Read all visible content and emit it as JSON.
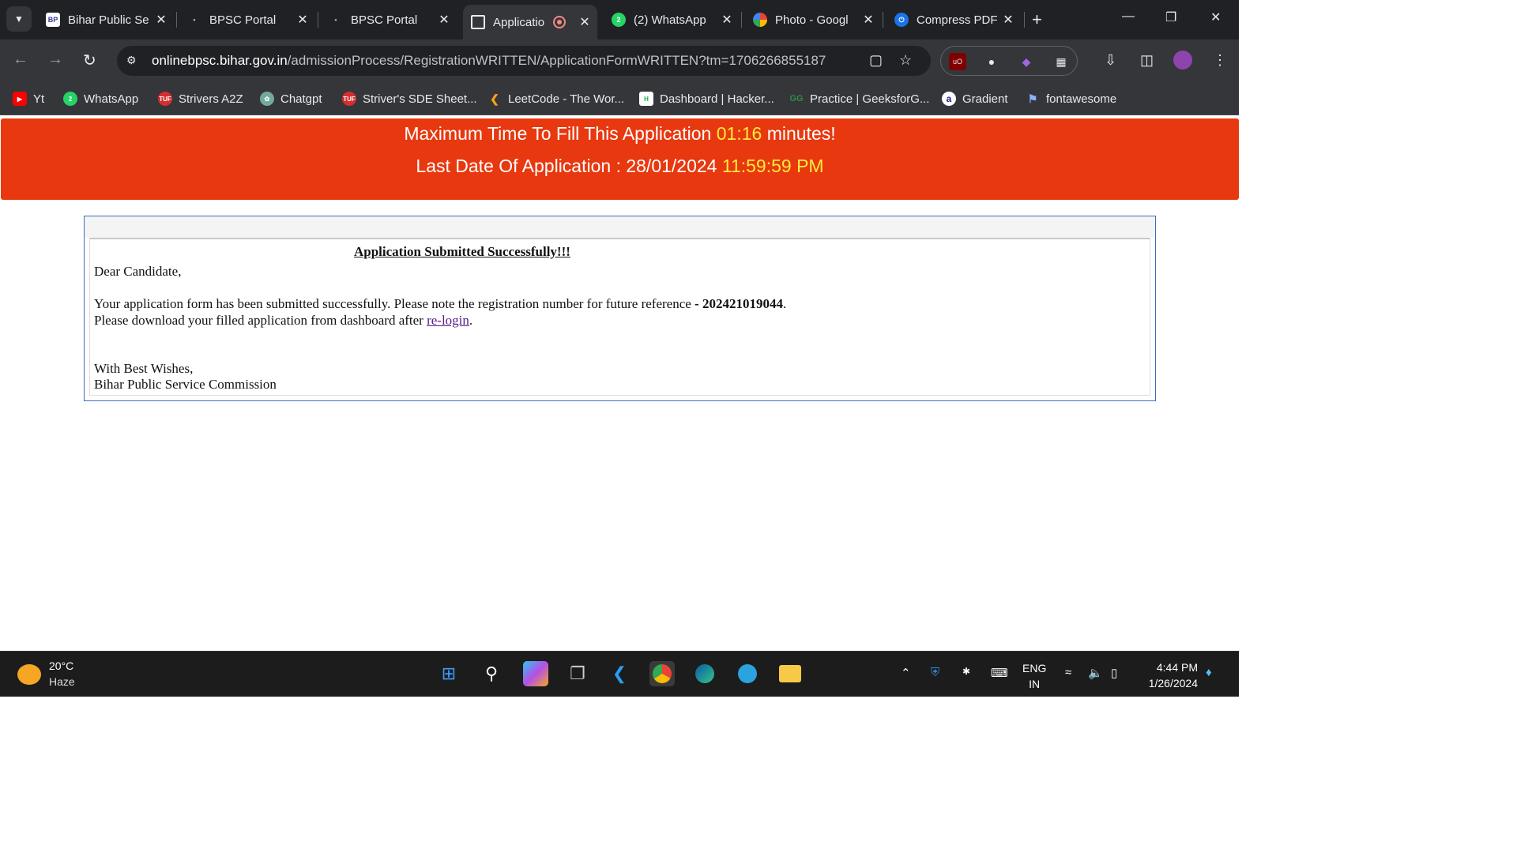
{
  "browser": {
    "tabs": [
      {
        "title": "Bihar Public Se",
        "icon": "bpsc-logo-icon",
        "active": false
      },
      {
        "title": "BPSC Portal",
        "icon": "bpsc-portal-icon",
        "active": false
      },
      {
        "title": "BPSC Portal",
        "icon": "bpsc-portal-icon",
        "active": false
      },
      {
        "title": "Applicatio",
        "icon": "application-page-icon",
        "active": true
      },
      {
        "title": "(2) WhatsApp",
        "icon": "whatsapp-icon",
        "active": false
      },
      {
        "title": "Photo - Googl",
        "icon": "google-photos-icon",
        "active": false
      },
      {
        "title": "Compress PDF",
        "icon": "compress-pdf-icon",
        "active": false
      }
    ],
    "whatsapp_badge": "2",
    "url_host": "onlinebpsc.bihar.gov.in",
    "url_path": "/admissionProcess/RegistrationWRITTEN/ApplicationFormWRITTEN?tm=1706266855187",
    "bookmarks": [
      {
        "label": "Yt",
        "icon": "youtube-icon"
      },
      {
        "label": "WhatsApp",
        "icon": "whatsapp-icon"
      },
      {
        "label": "Strivers A2Z",
        "icon": "tuf-icon"
      },
      {
        "label": "Chatgpt",
        "icon": "chatgpt-icon"
      },
      {
        "label": "Striver's SDE Sheet...",
        "icon": "tuf-icon"
      },
      {
        "label": "LeetCode - The Wor...",
        "icon": "leetcode-icon"
      },
      {
        "label": "Dashboard | Hacker...",
        "icon": "hackerrank-icon"
      },
      {
        "label": "Practice | GeeksforG...",
        "icon": "geeksforgeeks-icon"
      },
      {
        "label": "Gradient",
        "icon": "gradient-icon"
      },
      {
        "label": "fontawesome",
        "icon": "flag-icon"
      }
    ]
  },
  "banner": {
    "line1_prefix": "Maximum Time To Fill This Application",
    "timer": "01:16",
    "line1_suffix": "minutes!",
    "line2_prefix": "Last Date Of Application : 28/01/2024",
    "deadline_time": "11:59:59 PM",
    "background": "#e8380f",
    "highlight": "#ffeb3b"
  },
  "message": {
    "title": "Application Submitted Successfully!!!",
    "greeting": "Dear Candidate,",
    "body_prefix": "Your application form has been submitted successfully. Please note the registration number for future reference",
    "dash": "-",
    "registration_number": "202421019044",
    "period": ".",
    "download_prefix": "Please download your filled application from dashboard after",
    "relogin_link": "re-login",
    "download_suffix": ".",
    "closing": "With Best Wishes,",
    "signature": "Bihar Public Service Commission"
  },
  "taskbar": {
    "temperature": "20°C",
    "condition": "Haze",
    "language_top": "ENG",
    "language_bottom": "IN",
    "time": "4:44 PM",
    "date": "1/26/2024"
  }
}
